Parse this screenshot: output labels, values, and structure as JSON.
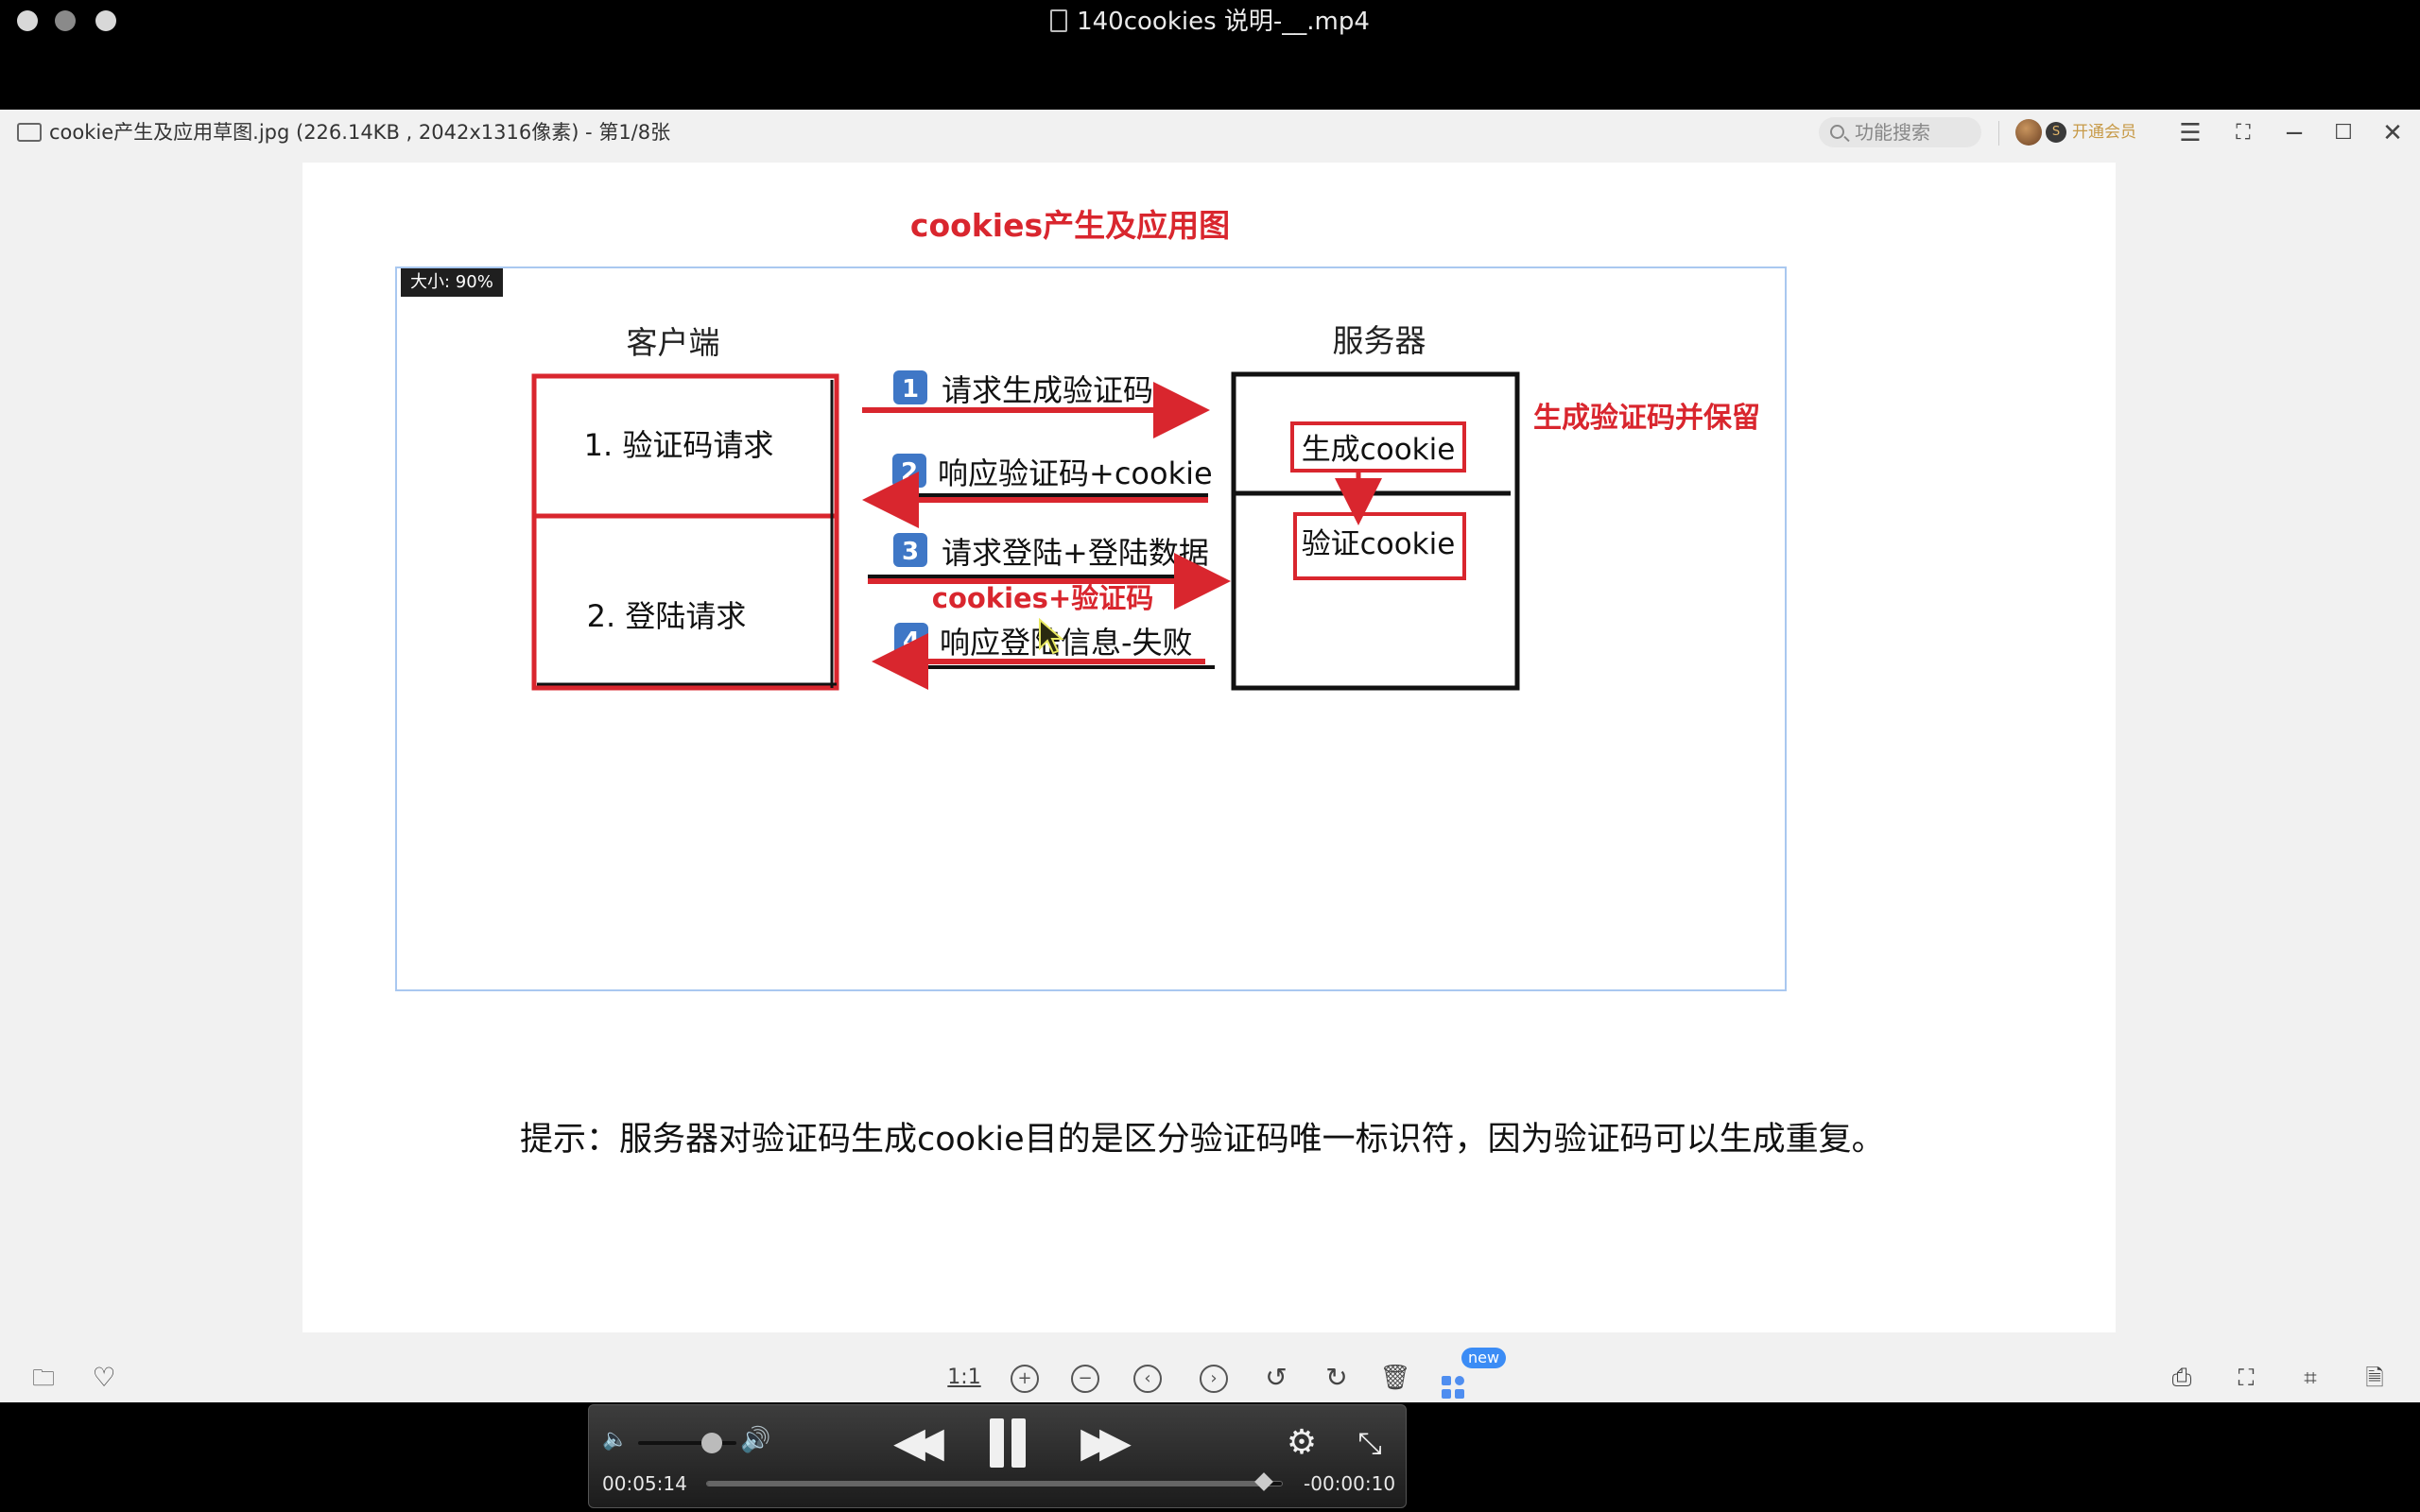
{
  "video_window": {
    "title": "140cookies 说明-__.mp4"
  },
  "viewer": {
    "file_info": "cookie产生及应用草图.jpg (226.14KB , 2042x1316像素) - 第1/8张",
    "search_placeholder": "功能搜索",
    "vip_label": "开通会员",
    "zoom_label": "大小: 90%",
    "toolbar": {
      "actual_size": "1:1",
      "new_badge": "new"
    }
  },
  "diagram": {
    "title": "cookies产生及应用图",
    "client_label": "客户端",
    "server_label": "服务器",
    "client_box_1": "1. 验证码请求",
    "client_box_2": "2. 登陆请求",
    "step1_num": "1",
    "step1": "请求生成验证码",
    "step2_num": "2",
    "step2": "响应验证码+cookie",
    "step3_num": "3",
    "step3": "请求登陆+登陆数据",
    "step3_sub": "cookies+验证码",
    "step4_num": "4",
    "step4": "响应登陆信息-失败",
    "server_gen": "生成cookie",
    "server_verify": "验证cookie",
    "server_note": "生成验证码并保留",
    "accent_color": "#d9262e"
  },
  "tip": "提示：服务器对验证码生成cookie目的是区分验证码唯一标识符，因为验证码可以生成重复。",
  "player": {
    "elapsed": "00:05:14",
    "remaining": "-00:00:10",
    "progress": 0.97,
    "volume": 0.75
  }
}
